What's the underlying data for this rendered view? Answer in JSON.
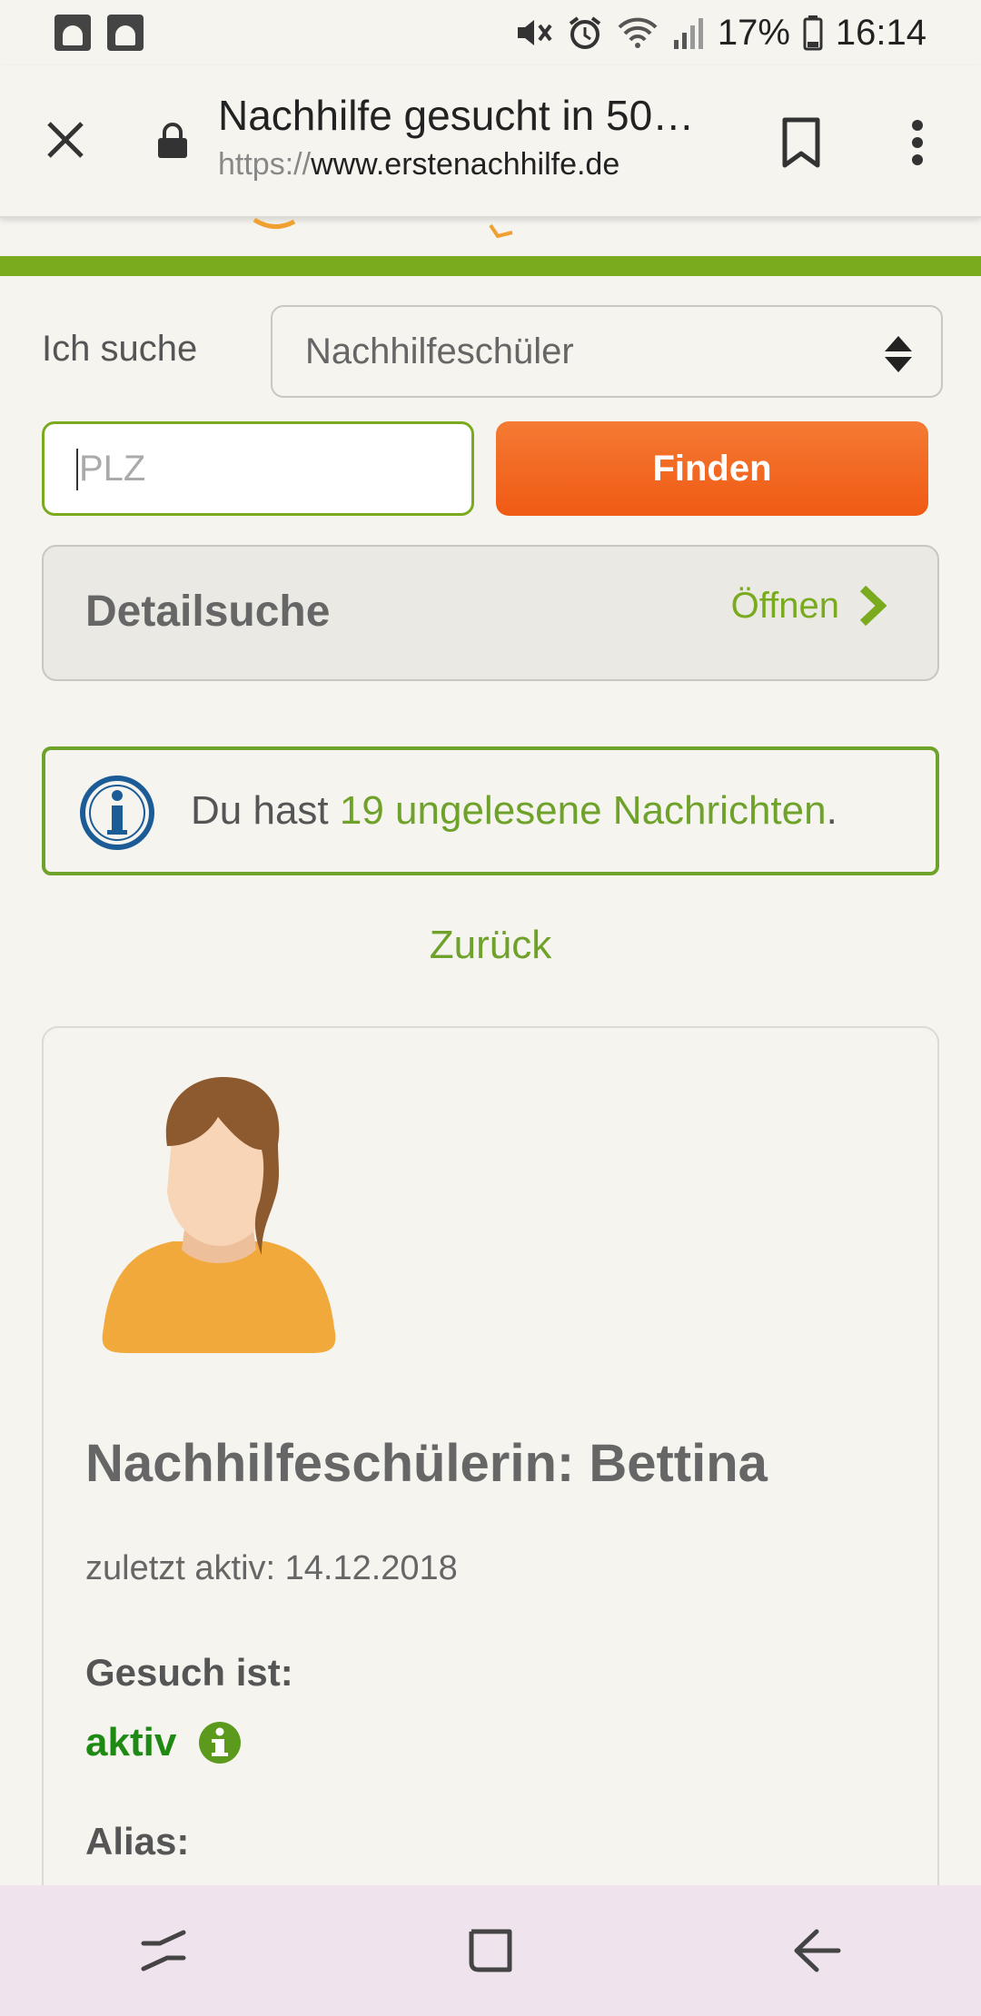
{
  "status_bar": {
    "battery": "17%",
    "time": "16:14"
  },
  "browser": {
    "title": "Nachhilfe gesucht in 50…",
    "url_scheme": "https://",
    "url_host": "www.erstenachhilfe.de"
  },
  "search": {
    "label": "Ich suche",
    "select_value": "Nachhilfeschüler",
    "plz_placeholder": "PLZ",
    "find_label": "Finden"
  },
  "detail": {
    "title": "Detailsuche",
    "open_label": "Öffnen"
  },
  "info": {
    "prefix": "Du hast ",
    "link_text": "19 ungelesene Nachrichten",
    "suffix": "."
  },
  "back_label": "Zurück",
  "profile": {
    "name": "Nachhilfeschülerin: Bettina",
    "last_active": "zuletzt aktiv: 14.12.2018",
    "status_heading": "Gesuch ist:",
    "status_value": "aktiv",
    "alias_heading": "Alias:"
  },
  "colors": {
    "accent_green": "#7aab1f",
    "active_green": "#1f8a13",
    "button_orange": "#f05a14",
    "info_blue": "#1b5c96"
  },
  "icons": [
    "close-icon",
    "lock-icon",
    "bookmark-icon",
    "more-vert-icon",
    "chevron-right-icon",
    "info-icon",
    "recents-icon",
    "home-icon",
    "back-icon"
  ]
}
